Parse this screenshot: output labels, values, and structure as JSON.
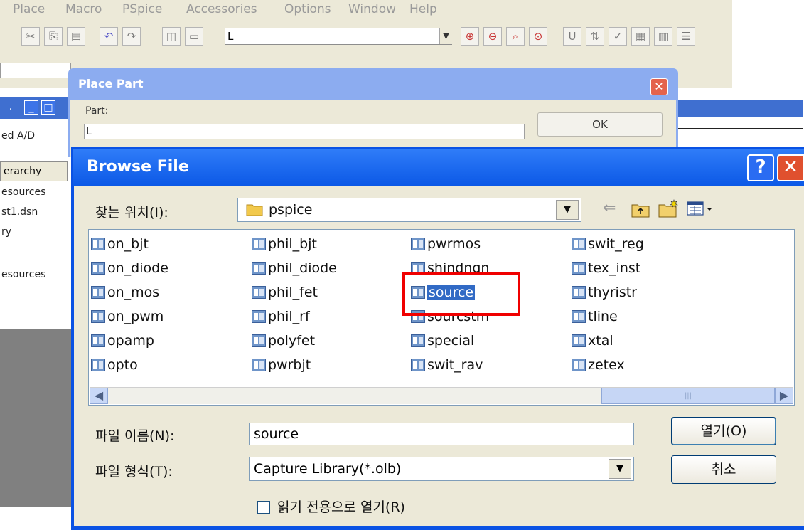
{
  "app": {
    "menu": [
      "Place",
      "Macro",
      "PSpice",
      "Accessories",
      "Options",
      "Window",
      "Help"
    ],
    "part_combo_value": "L",
    "left_panel": {
      "lines": [
        "ed A/D",
        "esources",
        "st1.dsn",
        "ry",
        "esources"
      ],
      "tab_label": "erarchy"
    }
  },
  "place_part": {
    "title": "Place Part",
    "part_label": "Part:",
    "part_value": "L",
    "ok_label": "OK"
  },
  "browse_file": {
    "title": "Browse File",
    "look_in_label": "찾는 위치(I):",
    "look_in_value": "pspice",
    "files": [
      [
        "on_bjt",
        "on_diode",
        "on_mos",
        "on_pwm",
        "opamp",
        "opto"
      ],
      [
        "phil_bjt",
        "phil_diode",
        "phil_fet",
        "phil_rf",
        "polyfet",
        "pwrbjt"
      ],
      [
        "pwrmos",
        "shindngn",
        "source",
        "sourcstm",
        "special",
        "swit_rav"
      ],
      [
        "swit_reg",
        "tex_inst",
        "thyristr",
        "tline",
        "xtal",
        "zetex"
      ]
    ],
    "selected_file": "source",
    "filename_label": "파일 이름(N):",
    "filename_value": "source",
    "filetype_label": "파일 형식(T):",
    "filetype_value": "Capture Library(*.olb)",
    "open_label": "열기(O)",
    "cancel_label": "취소",
    "readonly_label": "읽기 전용으로 열기(R)"
  },
  "colors": {
    "xp_title_blue": "#0b58e6",
    "dialog_face": "#ece9d8",
    "selection": "#316ac5",
    "highlight_red": "#f00000"
  }
}
